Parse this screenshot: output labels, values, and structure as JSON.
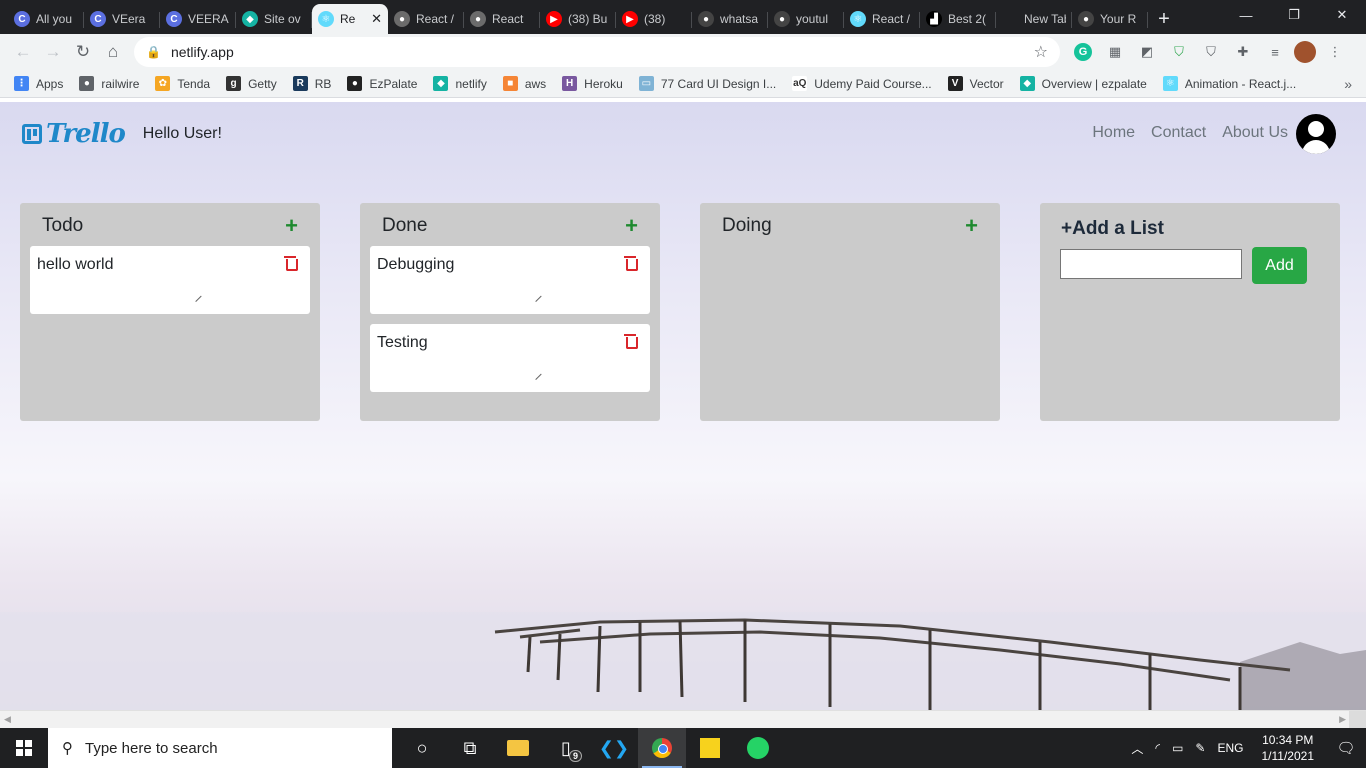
{
  "browser": {
    "tabs": [
      {
        "title": "All you",
        "favicon_color": "#5b6fe0",
        "favicon_glyph": "C"
      },
      {
        "title": "VEera",
        "favicon_color": "#5b6fe0",
        "favicon_glyph": "C"
      },
      {
        "title": "VEERA",
        "favicon_color": "#5b6fe0",
        "favicon_glyph": "C"
      },
      {
        "title": "Site ov",
        "favicon_color": "#15b3a3",
        "favicon_glyph": "◆"
      },
      {
        "title": "Re",
        "favicon_color": "#61dafb",
        "favicon_glyph": "⚛",
        "active": true
      },
      {
        "title": "React /",
        "favicon_color": "#6b6b6b",
        "favicon_glyph": "●"
      },
      {
        "title": "React",
        "favicon_color": "#6b6b6b",
        "favicon_glyph": "●"
      },
      {
        "title": "(38) Bu",
        "favicon_color": "#ff0000",
        "favicon_glyph": "▶"
      },
      {
        "title": "(38)",
        "favicon_color": "#ff0000",
        "favicon_glyph": "▶"
      },
      {
        "title": "whatsa",
        "favicon_color": "#444444",
        "favicon_glyph": "●"
      },
      {
        "title": "youtul",
        "favicon_color": "#444444",
        "favicon_glyph": "●"
      },
      {
        "title": "React /",
        "favicon_color": "#61dafb",
        "favicon_glyph": "⚛"
      },
      {
        "title": "Best 2(",
        "favicon_color": "#000000",
        "favicon_glyph": "▟"
      },
      {
        "title": "New Tab",
        "favicon_color": "",
        "favicon_glyph": ""
      },
      {
        "title": "Your R",
        "favicon_color": "#444444",
        "favicon_glyph": "●"
      }
    ],
    "active_tab_close": "✕",
    "new_tab": "+",
    "window_controls": {
      "minimize": "—",
      "restore": "❐",
      "close": "✕"
    },
    "nav": {
      "back": "←",
      "forward": "→",
      "reload": "↻",
      "home": "⌂"
    },
    "url": "netlify.app",
    "bookmark_star": "☆",
    "bookmarks": [
      {
        "label": "Apps",
        "icon_color": "#4285f4",
        "glyph": "⋮"
      },
      {
        "label": "railwire",
        "icon_color": "#5f6368",
        "glyph": "●"
      },
      {
        "label": "Tenda",
        "icon_color": "#f5a623",
        "glyph": "✿"
      },
      {
        "label": "Getty",
        "icon_color": "#333333",
        "glyph": "g"
      },
      {
        "label": "RB",
        "icon_color": "#1a3a5c",
        "glyph": "R"
      },
      {
        "label": "EzPalate",
        "icon_color": "#222222",
        "glyph": "●"
      },
      {
        "label": "netlify",
        "icon_color": "#15b3a3",
        "glyph": "◆"
      },
      {
        "label": "aws",
        "icon_color": "#f58536",
        "glyph": "■"
      },
      {
        "label": "Heroku",
        "icon_color": "#79589f",
        "glyph": "H"
      },
      {
        "label": "77 Card UI Design I...",
        "icon_color": "#7fb3d5",
        "glyph": "▭"
      },
      {
        "label": "Udemy Paid Course...",
        "icon_color": "#ffffff",
        "glyph": "aQ"
      },
      {
        "label": "Vector",
        "icon_color": "#222222",
        "glyph": "V"
      },
      {
        "label": "Overview | ezpalate",
        "icon_color": "#15b3a3",
        "glyph": "◆"
      },
      {
        "label": "Animation - React.j...",
        "icon_color": "#61dafb",
        "glyph": "⚛"
      }
    ],
    "bookmarks_more": "»"
  },
  "app": {
    "logo_text": "Trello",
    "greeting": "Hello User!",
    "nav_links": [
      "Home",
      "Contact",
      "About Us"
    ],
    "lists": [
      {
        "title": "Todo",
        "add_symbol": "+",
        "cards": [
          "hello world"
        ]
      },
      {
        "title": "Done",
        "add_symbol": "+",
        "cards": [
          "Debugging",
          "Testing"
        ]
      },
      {
        "title": "Doing",
        "add_symbol": "+",
        "cards": []
      }
    ],
    "add_list": {
      "title": "+Add a List",
      "input_value": "",
      "button_label": "Add"
    },
    "accent_colors": {
      "add_green": "#1e8a2f",
      "button_green": "#28a745",
      "trash_red": "#d9262b",
      "logo_blue": "#1f88c9"
    }
  },
  "taskbar": {
    "search_placeholder": "Type here to search",
    "apps": [
      "task-view",
      "file-explorer",
      "phone-link",
      "vscode",
      "chrome",
      "sticky-notes",
      "whatsapp"
    ],
    "badge_count": "9",
    "tray": {
      "language": "ENG",
      "time": "10:34 PM",
      "date": "1/11/2021"
    }
  }
}
